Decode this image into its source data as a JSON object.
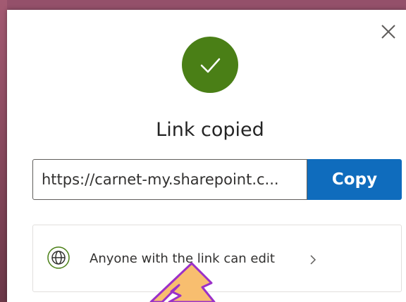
{
  "dialog": {
    "title": "Link copied",
    "link_input": {
      "value": "https://carnet-my.sharepoint.c..."
    },
    "copy_label": "Copy",
    "link_settings_label": "Anyone with the link can edit"
  },
  "icons": {
    "close": "close-icon",
    "success": "checkmark-icon",
    "link_scope": "globe-icon",
    "link_settings_chevron": "chevron-right-icon",
    "annotation": "pointer-arrow"
  },
  "colors": {
    "success": "#4a7f16",
    "primary": "#0f6cbd",
    "globe": "#4a7f16",
    "arrow_fill": "#f8be6f",
    "arrow_stroke": "#9b30c8"
  }
}
